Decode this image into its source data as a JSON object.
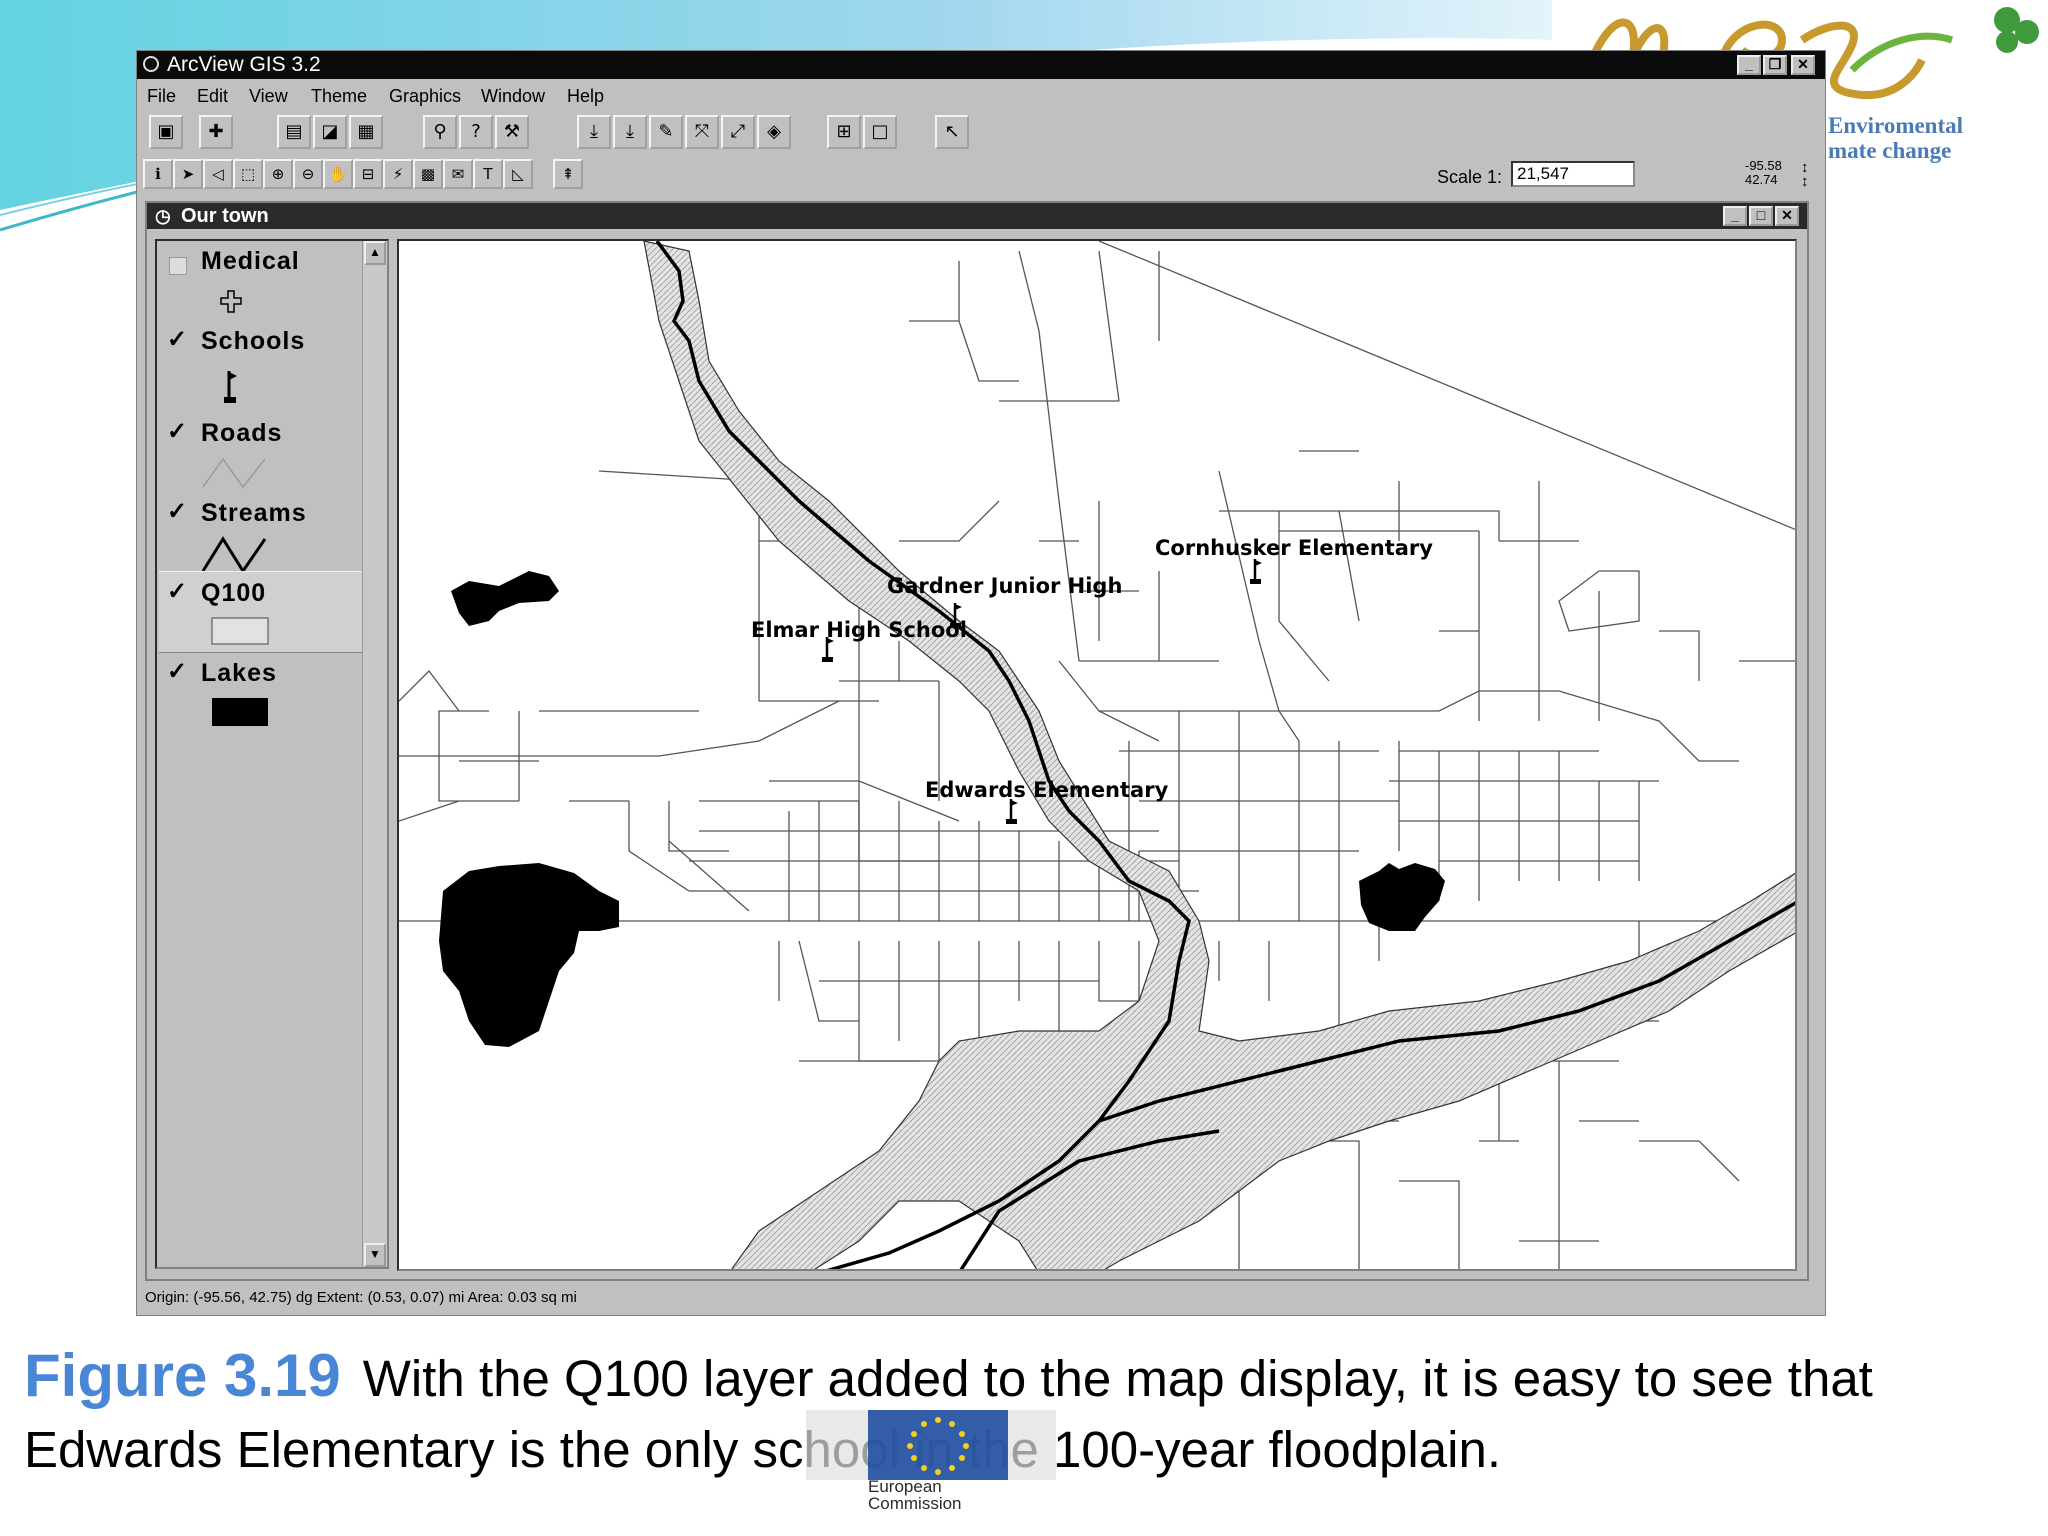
{
  "slide": {
    "logo": {
      "line1": "Enviromental",
      "line2": "mate change"
    },
    "caption": {
      "figure_number": "Figure 3.19",
      "text": "With the Q100 layer added to the map display, it is easy to see that Edwards Elementary is the only school in the 100-year floodplain."
    },
    "eu_logo": {
      "line1": "European",
      "line2": "Commission"
    }
  },
  "app": {
    "title": "ArcView GIS 3.2",
    "menu": [
      "File",
      "Edit",
      "View",
      "Theme",
      "Graphics",
      "Window",
      "Help"
    ],
    "scale_label": "Scale 1:",
    "scale_value": "21,547",
    "coord_x": "-95.58",
    "coord_y": "42.74",
    "status": "Origin: (-95.56, 42.75) dg  Extent: (0.53, 0.07) mi  Area: 0.03 sq mi"
  },
  "view": {
    "title": "Our town",
    "layers": [
      {
        "name": "Medical",
        "checked": false,
        "symbol": "cross-icon"
      },
      {
        "name": "Schools",
        "checked": true,
        "symbol": "flag-icon"
      },
      {
        "name": "Roads",
        "checked": true,
        "symbol": "thin-line"
      },
      {
        "name": "Streams",
        "checked": true,
        "symbol": "thick-line"
      },
      {
        "name": "Q100",
        "checked": true,
        "symbol": "gray-fill"
      },
      {
        "name": "Lakes",
        "checked": true,
        "symbol": "black-fill"
      }
    ],
    "check_mark": "✓",
    "map_labels": {
      "cornhusker": "Cornhusker Elementary",
      "gardner": "Gardner Junior High",
      "elmar": "Elmar High School",
      "edwards": "Edwards Elementary"
    }
  }
}
